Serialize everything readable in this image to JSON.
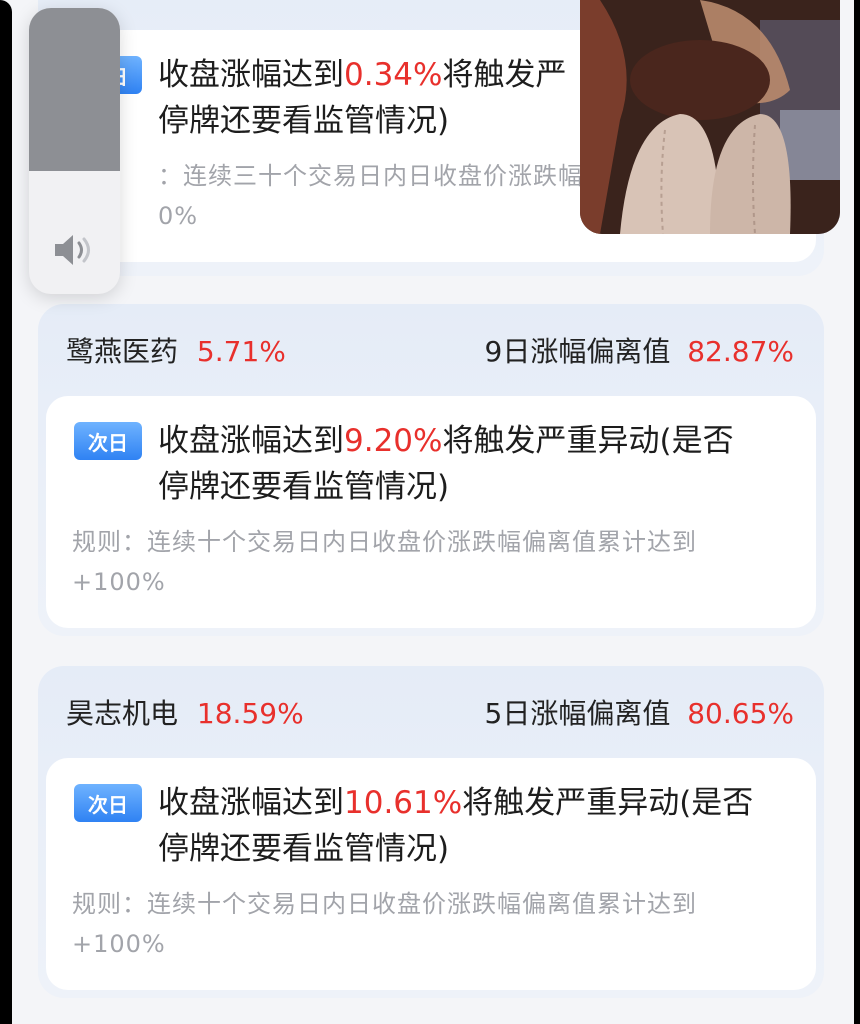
{
  "volume": {
    "level_percent": 43
  },
  "cards": [
    {
      "badge": "次日",
      "alert_prefix": "收盘涨幅达到",
      "alert_value": "0.34%",
      "alert_suffix": "将触发严",
      "alert_line2": "停牌还要看监管情况)",
      "rule_line1": "：连续三十个交易日内日收盘价涨跌幅",
      "rule_line2": "0%"
    },
    {
      "name": "鹭燕医药",
      "change": "5.71%",
      "deviation_label": "9日涨幅偏离值",
      "deviation_value": "82.87%",
      "badge": "次日",
      "alert_prefix": "收盘涨幅达到",
      "alert_value": "9.20%",
      "alert_suffix": "将触发严重异动(是否",
      "alert_line2": "停牌还要看监管情况)",
      "rule_line1": "规则：连续十个交易日内日收盘价涨跌幅偏离值累计达到",
      "rule_line2": "+100%"
    },
    {
      "name": "昊志机电",
      "change": "18.59%",
      "deviation_label": "5日涨幅偏离值",
      "deviation_value": "80.65%",
      "badge": "次日",
      "alert_prefix": "收盘涨幅达到",
      "alert_value": "10.61%",
      "alert_suffix": "将触发严重异动(是否",
      "alert_line2": "停牌还要看监管情况)",
      "rule_line1": "规则：连续十个交易日内日收盘价涨跌幅偏离值累计达到",
      "rule_line2": "+100%"
    }
  ]
}
